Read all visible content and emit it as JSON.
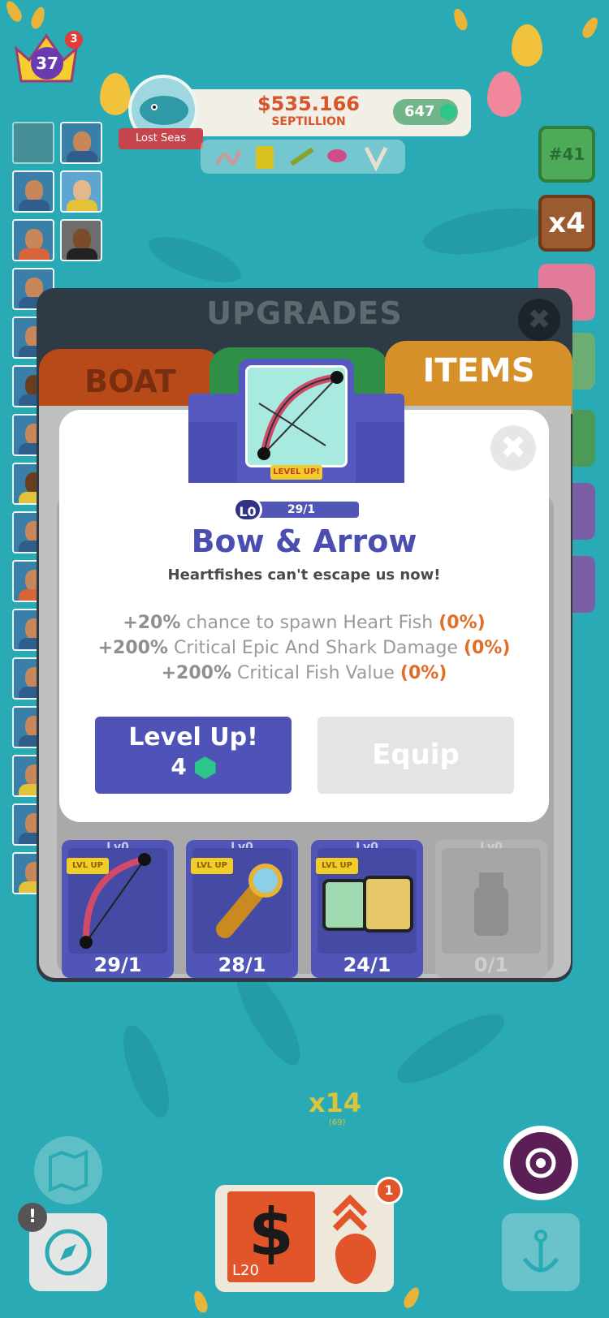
{
  "hud": {
    "player_level": "37",
    "crown_badge": "3",
    "money": "$535.166",
    "money_unit": "SEPTILLION",
    "gems": "647",
    "location": "Lost Seas",
    "rank": "#41",
    "boost": "x4"
  },
  "upgrades": {
    "title": "UPGRADES",
    "tabs": [
      "BOAT",
      "ITEMS"
    ],
    "cards": [
      {
        "level": "Lv0",
        "badge": "LVL UP",
        "count": "29/1",
        "icon": "bow-icon"
      },
      {
        "level": "Lv0",
        "badge": "LVL UP",
        "count": "28/1",
        "icon": "spyglass-icon"
      },
      {
        "level": "Lv0",
        "badge": "LVL UP",
        "count": "24/1",
        "icon": "line-spool-icon"
      },
      {
        "level": "Lv0",
        "badge": "",
        "count": "0/1",
        "icon": "bottle-icon"
      }
    ]
  },
  "popup": {
    "tag": "LEVEL UP!",
    "level": "L0",
    "progress": "29/1",
    "progress_fraction": 1.0,
    "title": "Bow & Arrow",
    "subtitle": "Heartfishes can't escape us now!",
    "stats": [
      {
        "amount": "+20%",
        "text": "chance to spawn Heart Fish",
        "current": "(0%)"
      },
      {
        "amount": "+200%",
        "text": "Critical Epic And Shark Damage",
        "current": "(0%)"
      },
      {
        "amount": "+200%",
        "text": "Critical Fish Value",
        "current": "(0%)"
      }
    ],
    "level_up_label": "Level Up!",
    "level_up_cost": "4",
    "equip_label": "Equip"
  },
  "bottom": {
    "multiplier": "x14",
    "multiplier_sub": "(69)",
    "income_level": "L20",
    "notification": "1"
  }
}
